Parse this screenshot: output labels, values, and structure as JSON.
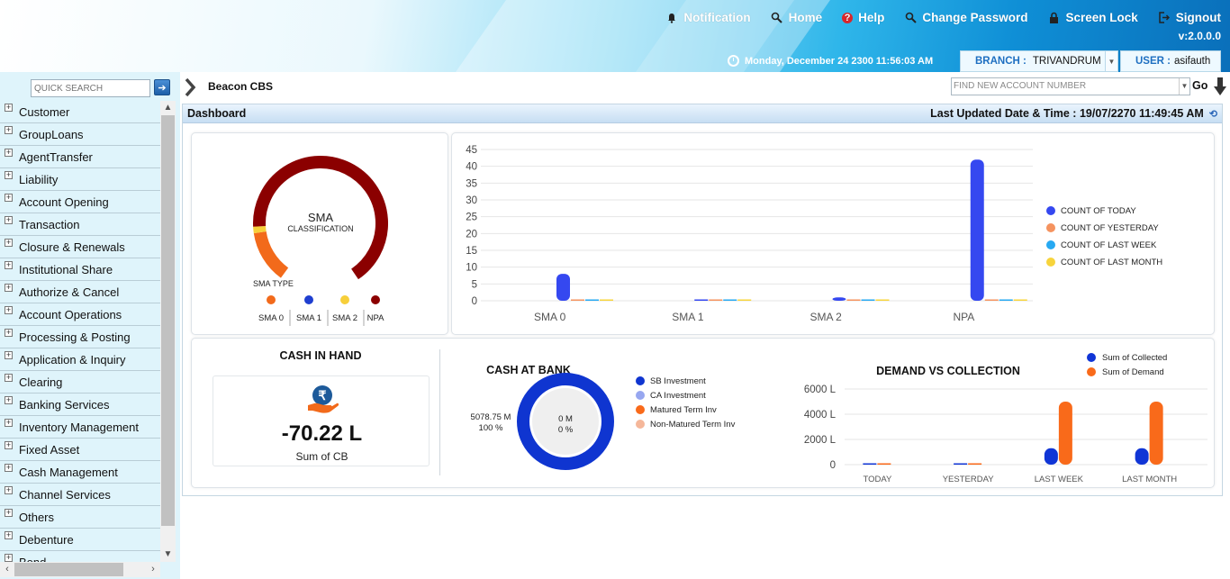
{
  "header": {
    "links": [
      {
        "label": "Notification",
        "icon": "bell-icon"
      },
      {
        "label": "Home",
        "icon": "search-icon"
      },
      {
        "label": "Help",
        "icon": "help-icon"
      },
      {
        "label": "Change Password",
        "icon": "key-icon"
      },
      {
        "label": "Screen Lock",
        "icon": "lock-icon"
      },
      {
        "label": "Signout",
        "icon": "signout-icon"
      }
    ],
    "version": "v:2.0.0.0",
    "datetime": "Monday, December 24 2300 11:56:03 AM",
    "branch_label": "BRANCH :",
    "branch_value": "TRIVANDRUM",
    "user_label": "USER :",
    "user_value": "asifauth"
  },
  "sidebar": {
    "quick_search_placeholder": "QUICK SEARCH",
    "items": [
      "Customer",
      "GroupLoans",
      "AgentTransfer",
      "Liability",
      "Account Opening",
      "Transaction",
      "Closure & Renewals",
      "Institutional Share",
      "Authorize & Cancel",
      "Account Operations",
      "Processing & Posting",
      "Application & Inquiry",
      "Clearing",
      "Banking Services",
      "Inventory Management",
      "Fixed Asset",
      "Cash Management",
      "Channel Services",
      "Others",
      "Debenture",
      "Bond"
    ]
  },
  "breadcrumb": {
    "label": "Beacon CBS"
  },
  "find_account": {
    "placeholder": "FIND NEW ACCOUNT NUMBER",
    "go_label": "Go"
  },
  "dashboard": {
    "title": "Dashboard",
    "last_updated_label": "Last Updated Date & Time : 19/07/2270 11:49:45 AM"
  },
  "sma_gauge": {
    "title": "SMA",
    "subtitle": "CLASSIFICATION",
    "type_label": "SMA TYPE",
    "legend": [
      {
        "label": "SMA 0",
        "color": "#f26a1b"
      },
      {
        "label": "SMA 1",
        "color": "#1f3fd0"
      },
      {
        "label": "SMA 2",
        "color": "#f7cf3a"
      },
      {
        "label": "NPA",
        "color": "#8b0000"
      }
    ],
    "segments": [
      {
        "label": "SMA 0",
        "value": 8,
        "color": "#f26a1b"
      },
      {
        "label": "SMA 1",
        "value": 0,
        "color": "#1f3fd0"
      },
      {
        "label": "SMA 2",
        "value": 1,
        "color": "#f7cf3a"
      },
      {
        "label": "NPA",
        "value": 42,
        "color": "#8b0000"
      }
    ]
  },
  "chart_data": [
    {
      "type": "bar",
      "categories": [
        "SMA 0",
        "SMA 1",
        "SMA 2",
        "NPA"
      ],
      "ylim": [
        0,
        45
      ],
      "yticks": [
        0,
        5,
        10,
        15,
        20,
        25,
        30,
        35,
        40,
        45
      ],
      "legend_position": "right",
      "series": [
        {
          "name": "COUNT OF TODAY",
          "color": "#3548f0",
          "values": [
            8,
            0,
            1,
            42
          ]
        },
        {
          "name": "COUNT OF YESTERDAY",
          "color": "#f5935f",
          "values": [
            0,
            0,
            0,
            0
          ]
        },
        {
          "name": "COUNT OF LAST WEEK",
          "color": "#27a9f2",
          "values": [
            0,
            0,
            0,
            0
          ]
        },
        {
          "name": "COUNT OF LAST MONTH",
          "color": "#f7d43c",
          "values": [
            0,
            0,
            0,
            0
          ]
        }
      ]
    },
    {
      "type": "bar",
      "title": "DEMAND VS COLLECTION",
      "categories": [
        "TODAY",
        "YESTERDAY",
        "LAST WEEK",
        "LAST MONTH"
      ],
      "ylim": [
        0,
        6000
      ],
      "yticks": [
        0,
        2000,
        4000,
        6000
      ],
      "ytick_labels": [
        "0",
        "2000 L",
        "4000 L",
        "6000 L"
      ],
      "legend_position": "top-right",
      "series": [
        {
          "name": "Sum of Collected",
          "color": "#1035d6",
          "values": [
            50,
            20,
            1300,
            1300
          ]
        },
        {
          "name": "Sum of Demand",
          "color": "#f96a1a",
          "values": [
            50,
            20,
            5000,
            5000
          ]
        }
      ]
    },
    {
      "type": "pie",
      "title": "CASH AT BANK",
      "center_label_1": "0 M",
      "center_label_2": "0 %",
      "side_label_1": "5078.75 M",
      "side_label_2": "100 %",
      "series": [
        {
          "name": "SB Investment",
          "color": "#0f35d0",
          "value": 100
        },
        {
          "name": "CA Investment",
          "color": "#97a7f0",
          "value": 0
        },
        {
          "name": "Matured Term Inv",
          "color": "#f96a1a",
          "value": 0
        },
        {
          "name": "Non-Matured Term Inv",
          "color": "#f5b79a",
          "value": 0
        }
      ]
    }
  ],
  "cash_in_hand": {
    "title": "CASH IN HAND",
    "amount": "-70.22 L",
    "caption": "Sum of CB",
    "icon": "rupee-hand-icon"
  }
}
